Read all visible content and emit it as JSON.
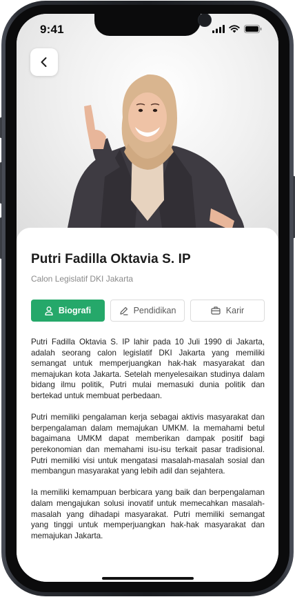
{
  "status_bar": {
    "time": "9:41"
  },
  "nav": {
    "back_icon": "chevron-left-icon"
  },
  "profile": {
    "name": "Putri Fadilla Oktavia S. IP",
    "role": "Calon Legislatif DKI Jakarta"
  },
  "tabs": [
    {
      "label": "Biografi",
      "icon": "user-icon",
      "active": true
    },
    {
      "label": "Pendidikan",
      "icon": "pen-icon",
      "active": false
    },
    {
      "label": "Karir",
      "icon": "briefcase-icon",
      "active": false
    }
  ],
  "biography": [
    "Putri Fadilla Oktavia S. IP lahir pada 10 Juli 1990 di Jakarta, adalah seorang calon legislatif DKI Jakarta yang memiliki semangat untuk memperjuangkan hak-hak masyarakat dan memajukan kota Jakarta. Setelah menyelesaikan studinya dalam bidang ilmu politik, Putri mulai memasuki dunia politik dan bertekad untuk membuat perbedaan.",
    "Putri memiliki pengalaman kerja sebagai aktivis masyarakat dan berpengalaman dalam memajukan UMKM. Ia memahami betul bagaimana UMKM dapat memberikan dampak positif bagi perekonomian dan memahami isu-isu terkait pasar tradisional. Putri memiliki visi untuk mengatasi masalah-masalah sosial dan membangun masyarakat yang lebih adil dan sejahtera.",
    "Ia memiliki kemampuan berbicara yang baik dan berpengalaman dalam mengajukan solusi inovatif untuk memecahkan masalah-masalah yang dihadapi masyarakat. Putri memiliki semangat yang tinggi untuk memperjuangkan hak-hak masyarakat dan memajukan Jakarta."
  ],
  "colors": {
    "accent": "#25a86a",
    "text": "#1c1c1c",
    "muted": "#8a8a8a"
  }
}
